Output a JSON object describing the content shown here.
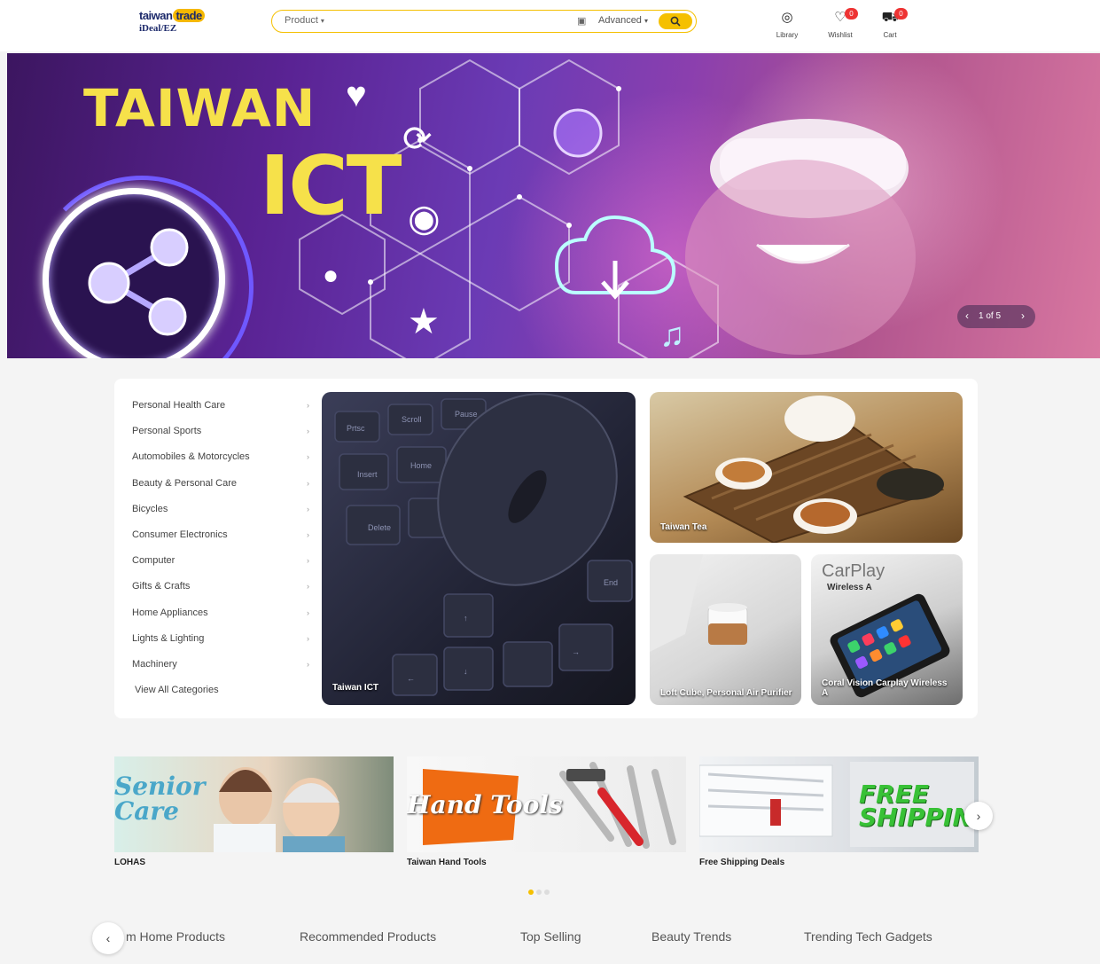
{
  "logo": {
    "line1_a": "taiwan",
    "line1_b": "trade",
    "line2": "iDeal/EZ"
  },
  "search": {
    "category": "Product",
    "advanced": "Advanced"
  },
  "nav": [
    {
      "label": "Library"
    },
    {
      "label": "Wishlist",
      "badge": "0"
    },
    {
      "label": "Cart",
      "badge": "0"
    }
  ],
  "hero": {
    "title_line1": "TAIWAN",
    "title_line2": "ICT",
    "counter": "1 of 5"
  },
  "categories": [
    "Personal Health Care",
    "Personal Sports",
    "Automobiles & Motorcycles",
    "Beauty & Personal Care",
    "Bicycles",
    "Consumer Electronics",
    "Computer",
    "Gifts & Crafts",
    "Home Appliances",
    "Lights & Lighting",
    "Machinery",
    "View All Categories"
  ],
  "tiles": {
    "ict": "Taiwan ICT",
    "tea": "Taiwan Tea",
    "air": "Loft Cube, Personal Air Purifier",
    "carplay": "Coral Vision Carplay Wireless A",
    "carplay_brand": "CarPlay",
    "carplay_sub": "Wireless A"
  },
  "promos": [
    {
      "label": "LOHAS",
      "art_text": "Senior Care"
    },
    {
      "label": "Taiwan Hand Tools",
      "art_text": "Hand Tools"
    },
    {
      "label": "Free Shipping Deals",
      "art_text": "FREE SHIPPING"
    }
  ],
  "tabs": [
    "m Home Products",
    "Recommended Products",
    "Top Selling",
    "Beauty Trends",
    "Trending Tech Gadgets"
  ],
  "colors": {
    "accent": "#f5c000",
    "hero_title": "#f6e14a",
    "badge": "#e33333"
  }
}
